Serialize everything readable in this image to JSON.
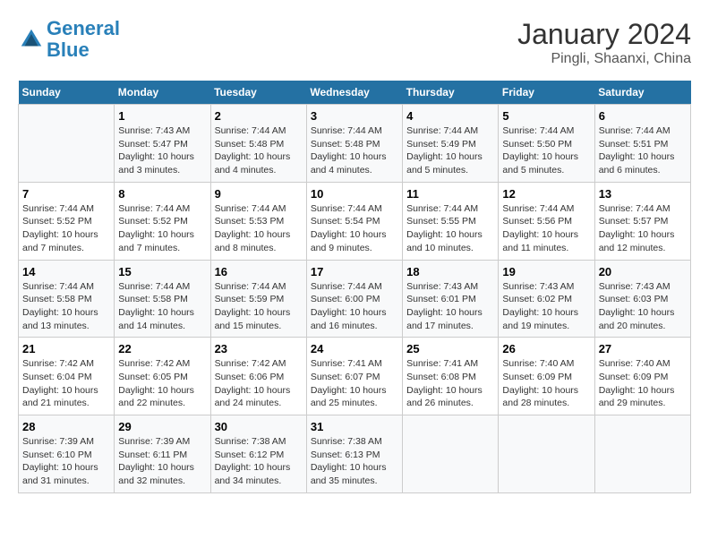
{
  "logo": {
    "line1": "General",
    "line2": "Blue"
  },
  "title": "January 2024",
  "subtitle": "Pingli, Shaanxi, China",
  "days_of_week": [
    "Sunday",
    "Monday",
    "Tuesday",
    "Wednesday",
    "Thursday",
    "Friday",
    "Saturday"
  ],
  "weeks": [
    [
      {
        "day": "",
        "info": ""
      },
      {
        "day": "1",
        "info": "Sunrise: 7:43 AM\nSunset: 5:47 PM\nDaylight: 10 hours and 3 minutes."
      },
      {
        "day": "2",
        "info": "Sunrise: 7:44 AM\nSunset: 5:48 PM\nDaylight: 10 hours and 4 minutes."
      },
      {
        "day": "3",
        "info": "Sunrise: 7:44 AM\nSunset: 5:48 PM\nDaylight: 10 hours and 4 minutes."
      },
      {
        "day": "4",
        "info": "Sunrise: 7:44 AM\nSunset: 5:49 PM\nDaylight: 10 hours and 5 minutes."
      },
      {
        "day": "5",
        "info": "Sunrise: 7:44 AM\nSunset: 5:50 PM\nDaylight: 10 hours and 5 minutes."
      },
      {
        "day": "6",
        "info": "Sunrise: 7:44 AM\nSunset: 5:51 PM\nDaylight: 10 hours and 6 minutes."
      }
    ],
    [
      {
        "day": "7",
        "info": "Sunrise: 7:44 AM\nSunset: 5:52 PM\nDaylight: 10 hours and 7 minutes."
      },
      {
        "day": "8",
        "info": "Sunrise: 7:44 AM\nSunset: 5:52 PM\nDaylight: 10 hours and 7 minutes."
      },
      {
        "day": "9",
        "info": "Sunrise: 7:44 AM\nSunset: 5:53 PM\nDaylight: 10 hours and 8 minutes."
      },
      {
        "day": "10",
        "info": "Sunrise: 7:44 AM\nSunset: 5:54 PM\nDaylight: 10 hours and 9 minutes."
      },
      {
        "day": "11",
        "info": "Sunrise: 7:44 AM\nSunset: 5:55 PM\nDaylight: 10 hours and 10 minutes."
      },
      {
        "day": "12",
        "info": "Sunrise: 7:44 AM\nSunset: 5:56 PM\nDaylight: 10 hours and 11 minutes."
      },
      {
        "day": "13",
        "info": "Sunrise: 7:44 AM\nSunset: 5:57 PM\nDaylight: 10 hours and 12 minutes."
      }
    ],
    [
      {
        "day": "14",
        "info": "Sunrise: 7:44 AM\nSunset: 5:58 PM\nDaylight: 10 hours and 13 minutes."
      },
      {
        "day": "15",
        "info": "Sunrise: 7:44 AM\nSunset: 5:58 PM\nDaylight: 10 hours and 14 minutes."
      },
      {
        "day": "16",
        "info": "Sunrise: 7:44 AM\nSunset: 5:59 PM\nDaylight: 10 hours and 15 minutes."
      },
      {
        "day": "17",
        "info": "Sunrise: 7:44 AM\nSunset: 6:00 PM\nDaylight: 10 hours and 16 minutes."
      },
      {
        "day": "18",
        "info": "Sunrise: 7:43 AM\nSunset: 6:01 PM\nDaylight: 10 hours and 17 minutes."
      },
      {
        "day": "19",
        "info": "Sunrise: 7:43 AM\nSunset: 6:02 PM\nDaylight: 10 hours and 19 minutes."
      },
      {
        "day": "20",
        "info": "Sunrise: 7:43 AM\nSunset: 6:03 PM\nDaylight: 10 hours and 20 minutes."
      }
    ],
    [
      {
        "day": "21",
        "info": "Sunrise: 7:42 AM\nSunset: 6:04 PM\nDaylight: 10 hours and 21 minutes."
      },
      {
        "day": "22",
        "info": "Sunrise: 7:42 AM\nSunset: 6:05 PM\nDaylight: 10 hours and 22 minutes."
      },
      {
        "day": "23",
        "info": "Sunrise: 7:42 AM\nSunset: 6:06 PM\nDaylight: 10 hours and 24 minutes."
      },
      {
        "day": "24",
        "info": "Sunrise: 7:41 AM\nSunset: 6:07 PM\nDaylight: 10 hours and 25 minutes."
      },
      {
        "day": "25",
        "info": "Sunrise: 7:41 AM\nSunset: 6:08 PM\nDaylight: 10 hours and 26 minutes."
      },
      {
        "day": "26",
        "info": "Sunrise: 7:40 AM\nSunset: 6:09 PM\nDaylight: 10 hours and 28 minutes."
      },
      {
        "day": "27",
        "info": "Sunrise: 7:40 AM\nSunset: 6:09 PM\nDaylight: 10 hours and 29 minutes."
      }
    ],
    [
      {
        "day": "28",
        "info": "Sunrise: 7:39 AM\nSunset: 6:10 PM\nDaylight: 10 hours and 31 minutes."
      },
      {
        "day": "29",
        "info": "Sunrise: 7:39 AM\nSunset: 6:11 PM\nDaylight: 10 hours and 32 minutes."
      },
      {
        "day": "30",
        "info": "Sunrise: 7:38 AM\nSunset: 6:12 PM\nDaylight: 10 hours and 34 minutes."
      },
      {
        "day": "31",
        "info": "Sunrise: 7:38 AM\nSunset: 6:13 PM\nDaylight: 10 hours and 35 minutes."
      },
      {
        "day": "",
        "info": ""
      },
      {
        "day": "",
        "info": ""
      },
      {
        "day": "",
        "info": ""
      }
    ]
  ]
}
